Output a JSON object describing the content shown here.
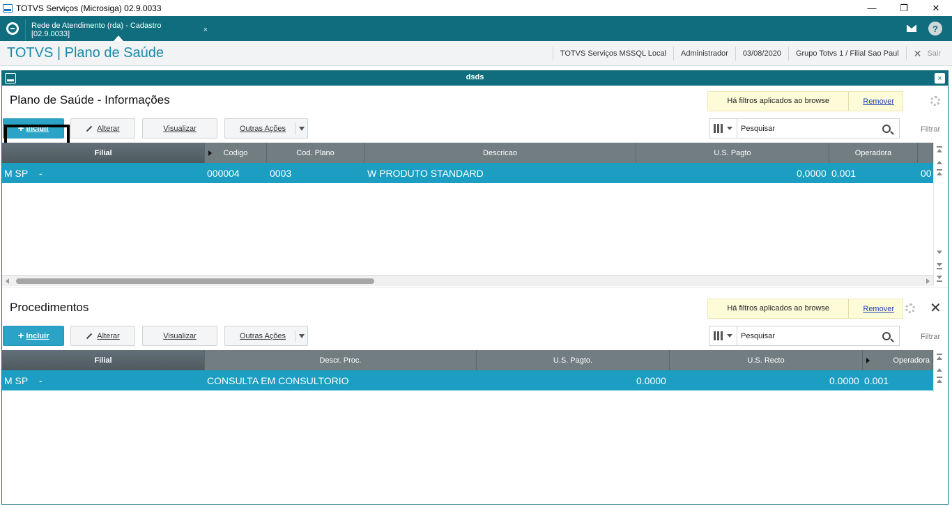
{
  "window": {
    "title": "TOTVS Serviços (Microsiga) 02.9.0033",
    "minimize": "—",
    "restore": "❐",
    "close": "✕"
  },
  "tabbar": {
    "tab_label": "Rede de Atendimento (rda) - Cadastro [02.9.0033]",
    "tab_close": "×",
    "help": "?"
  },
  "header": {
    "brand": "TOTVS | Plano de Saúde",
    "environment": "TOTVS Serviços MSSQL Local",
    "user": "Administrador",
    "date": "03/08/2020",
    "branch": "Grupo Totvs 1 / Filial Sao Paul",
    "exit_icon": "✕",
    "exit": "Sair"
  },
  "dialog": {
    "title": "dsds",
    "close": "×"
  },
  "section1": {
    "title": "Plano de Saúde - Informações",
    "filter_note": "Há filtros aplicados ao browse",
    "remove": "Remover",
    "btn_add_plus": "+",
    "btn_add": "Incluir",
    "btn_edit": "Alterar",
    "btn_view": "Visualizar",
    "btn_more": "Outras Ações",
    "search_placeholder": "Pesquisar",
    "filter": "Filtrar",
    "columns": [
      "Filial",
      "Codigo",
      "Cod. Plano",
      "Descricao",
      "U.S. Pagto",
      "Operadora"
    ],
    "rows": [
      {
        "filial": "M SP",
        "dash": "-",
        "codigo": "000004",
        "cod_plano": "0003",
        "descricao": "W PRODUTO STANDARD",
        "us_pagto": "0,0000",
        "operadora": "0.001",
        "extra": "00"
      }
    ]
  },
  "section2": {
    "title": "Procedimentos",
    "filter_note": "Há filtros aplicados ao browse",
    "remove": "Remover",
    "close": "✕",
    "btn_add_plus": "+",
    "btn_add": "Incluir",
    "btn_edit": "Alterar",
    "btn_view": "Visualizar",
    "btn_more": "Outras Ações",
    "search_placeholder": "Pesquisar",
    "filter": "Filtrar",
    "columns": [
      "Filial",
      "Descr. Proc.",
      "U.S.  Pagto.",
      "U.S. Recto",
      "Operadora"
    ],
    "rows": [
      {
        "filial": "M SP",
        "dash": "-",
        "descr": "CONSULTA EM CONSULTORIO",
        "us_pagto": "0.0000",
        "us_recto": "0.0000",
        "operadora": "0.001"
      }
    ]
  },
  "colors": {
    "teal": "#0f6d7e",
    "brand": "#1a8aa8",
    "row_selected": "#1b9ec2",
    "primary_button": "#2ba3c6"
  }
}
